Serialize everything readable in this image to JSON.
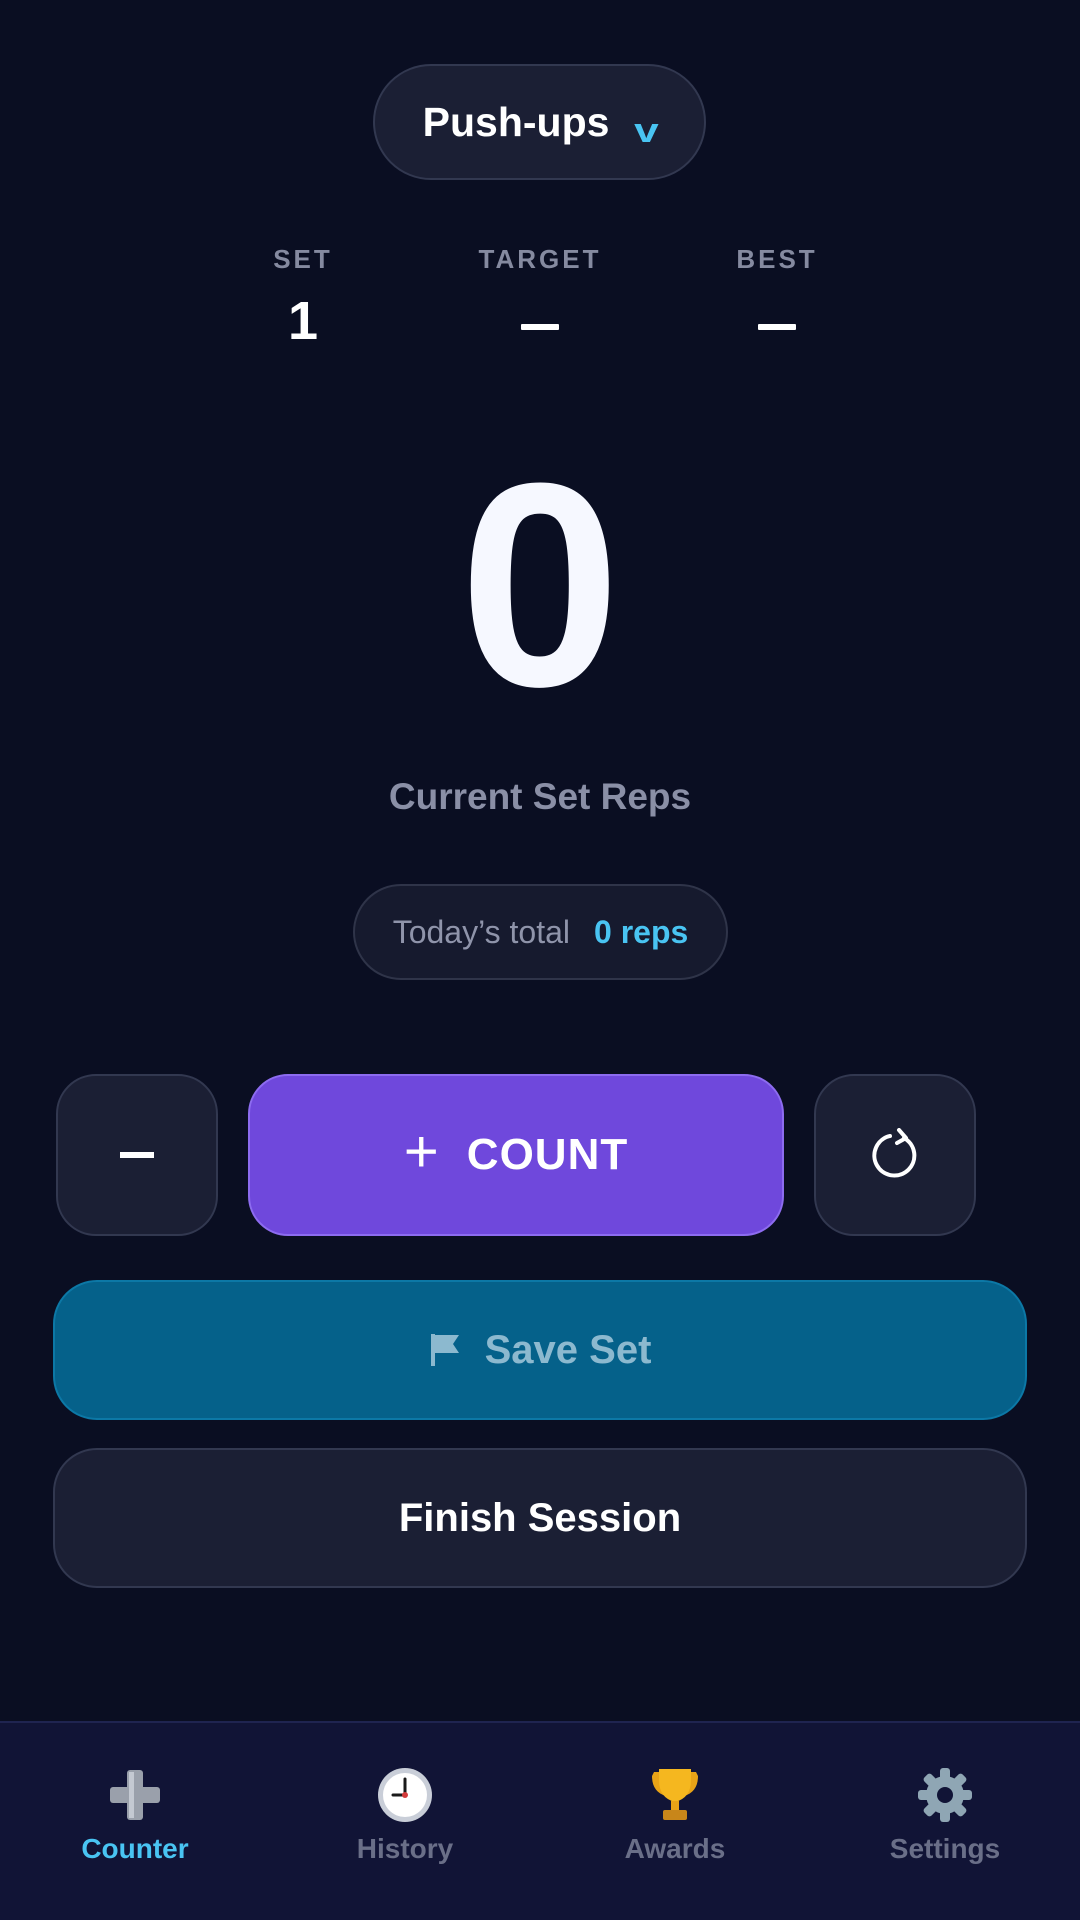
{
  "exercise": {
    "name": "Push-ups",
    "chevron": "v"
  },
  "stats": [
    {
      "label": "SET",
      "value": "1"
    },
    {
      "label": "TARGET",
      "value": "–"
    },
    {
      "label": "BEST",
      "value": "–"
    }
  ],
  "counter": {
    "value": "0",
    "caption": "Current Set Reps"
  },
  "today": {
    "label": "Today’s total",
    "value": "0 reps"
  },
  "controls": {
    "minus_icon": "minus-icon",
    "count_plus": "+",
    "count_label": "COUNT",
    "reset_icon": "reset-icon"
  },
  "save": {
    "label": "Save Set",
    "icon": "flag-icon"
  },
  "finish": {
    "label": "Finish Session"
  },
  "nav": [
    {
      "label": "Counter",
      "icon": "plus-icon",
      "active": true
    },
    {
      "label": "History",
      "icon": "clock-icon",
      "active": false
    },
    {
      "label": "Awards",
      "icon": "trophy-icon",
      "active": false
    },
    {
      "label": "Settings",
      "icon": "gear-icon",
      "active": false
    }
  ],
  "colors": {
    "background": "#0a0e22",
    "accent": "#49c4f2",
    "count_button": "#6f48dc",
    "save_button": "#05618a",
    "nav_background": "#111436"
  }
}
